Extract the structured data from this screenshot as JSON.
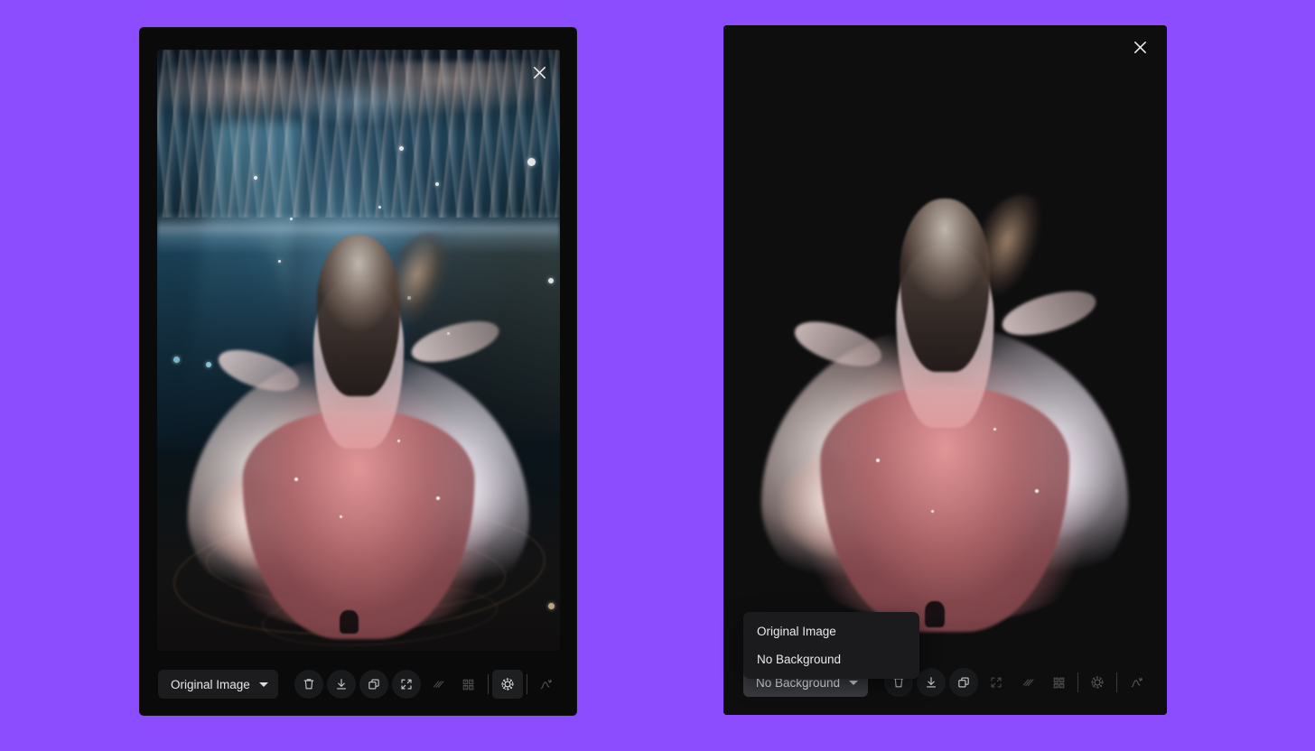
{
  "app": {
    "background_color": "#8B4DFF",
    "panel_background": "#0e0e0f"
  },
  "panels": [
    {
      "id": "original",
      "name": "original-image-panel",
      "close_label": "×",
      "mode_label": "Original Image",
      "image_description": "Woman in flowing pink and white dress dancing underwater with light rays and bubbles"
    },
    {
      "id": "no-background",
      "name": "no-background-panel",
      "close_label": "×",
      "mode_label": "No Background",
      "image_description": "Same woman in flowing pink and white dress isolated on solid dark background"
    }
  ],
  "dropdown": {
    "open": true,
    "selected": "No Background",
    "options": [
      {
        "label": "Original Image"
      },
      {
        "label": "No Background"
      }
    ]
  },
  "toolbar": {
    "buttons": [
      {
        "name": "delete-button",
        "icon": "trash-icon",
        "label": "Delete"
      },
      {
        "name": "download-button",
        "icon": "download-icon",
        "label": "Download"
      },
      {
        "name": "duplicate-button",
        "icon": "copy-icon",
        "label": "Duplicate"
      },
      {
        "name": "fullscreen-button",
        "icon": "expand-icon",
        "label": "Fullscreen"
      },
      {
        "name": "compare-button",
        "icon": "slashes-icon",
        "label": "Compare"
      }
    ],
    "magic_buttons": [
      {
        "name": "upscale-button",
        "icon": "pixel-grid-icon",
        "label": "Upscale"
      },
      {
        "name": "enhance-button",
        "icon": "sparkle-gear-icon",
        "label": "Enhance"
      },
      {
        "name": "variations-button",
        "icon": "magic-wand-icon",
        "label": "Variations"
      }
    ]
  }
}
